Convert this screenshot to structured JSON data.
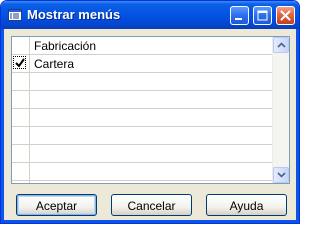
{
  "window": {
    "title": "Mostrar menús",
    "icons": {
      "app": "menu-window-icon",
      "minimize": "minimize-icon",
      "maximize": "maximize-icon",
      "close": "close-icon"
    }
  },
  "list": {
    "items": [
      {
        "label": "Fabricación",
        "checked": false
      },
      {
        "label": "Cartera",
        "checked": true
      }
    ],
    "empty_rows": 6
  },
  "buttons": {
    "accept": "Aceptar",
    "cancel": "Cancelar",
    "help": "Ayuda"
  },
  "colors": {
    "titlebar": "#0554e4",
    "dialog_bg": "#ece9d8",
    "close_button": "#e26541"
  }
}
